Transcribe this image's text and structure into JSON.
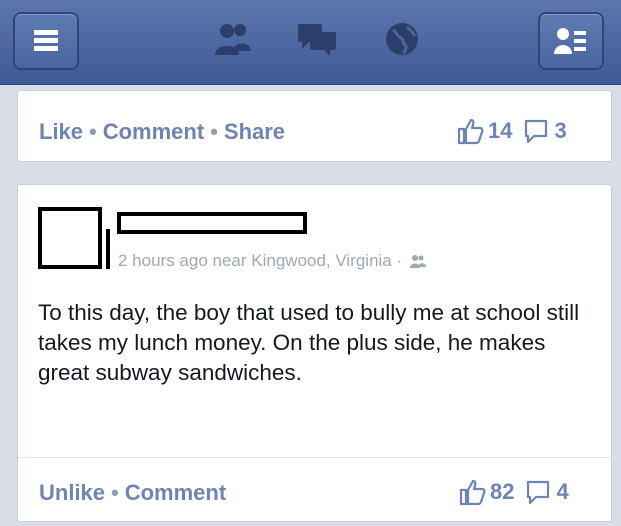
{
  "colors": {
    "header": "#3f5a96",
    "link": "#6d84b4",
    "meta": "#a1a7b3"
  },
  "header": {
    "icons": [
      "menu-icon",
      "friends-icon",
      "messages-icon",
      "globe-icon",
      "profile-list-icon"
    ]
  },
  "top_story": {
    "actions": {
      "like": "Like",
      "comment": "Comment",
      "share": "Share",
      "sep": "•"
    },
    "likes": "14",
    "comments": "3"
  },
  "post": {
    "meta": "2 hours ago near Kingwood, Virginia ·",
    "text": "To this day, the boy that used to bully me at school still takes my lunch money. On the plus side, he makes great subway sandwiches.",
    "actions": {
      "unlike": "Unlike",
      "comment": "Comment",
      "sep": "•"
    },
    "likes": "82",
    "comments": "4"
  }
}
